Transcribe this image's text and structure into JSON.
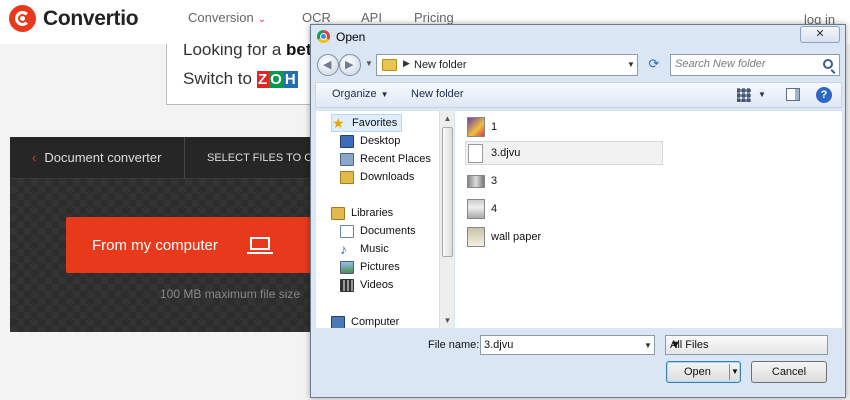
{
  "site": {
    "logo_text": "Convertio",
    "nav": {
      "conversion": "Conversion",
      "ocr": "OCR",
      "api": "API",
      "pricing": "Pricing",
      "login": "log in"
    },
    "ad": {
      "line1_prefix": "Looking for a ",
      "line1_bold": "bett",
      "line2": "Switch to",
      "zoho": [
        "Z",
        "O",
        "H",
        "O"
      ]
    },
    "converter": {
      "back_label": "Document converter",
      "select_label": "SELECT FILES TO CONV",
      "from_computer": "From my computer",
      "max_size": "100 MB maximum file size"
    }
  },
  "dialog": {
    "title": "Open",
    "close": "✕",
    "address_path": "New folder",
    "search_placeholder": "Search New folder",
    "toolbar": {
      "organize": "Organize",
      "new_folder": "New folder",
      "help": "?"
    },
    "tree": [
      {
        "label": "Favorites",
        "icon": "star-icon"
      },
      {
        "label": "Desktop",
        "icon": "desktop-icon"
      },
      {
        "label": "Recent Places",
        "icon": "recent-places-icon"
      },
      {
        "label": "Downloads",
        "icon": "downloads-icon"
      },
      {
        "label": "Libraries",
        "icon": "libraries-icon"
      },
      {
        "label": "Documents",
        "icon": "documents-icon"
      },
      {
        "label": "Music",
        "icon": "music-icon"
      },
      {
        "label": "Pictures",
        "icon": "pictures-icon"
      },
      {
        "label": "Videos",
        "icon": "videos-icon"
      },
      {
        "label": "Computer",
        "icon": "computer-icon"
      }
    ],
    "files": [
      {
        "name": "1",
        "icon": "image-file-icon"
      },
      {
        "name": "3.djvu",
        "icon": "document-file-icon",
        "selected": true
      },
      {
        "name": "3",
        "icon": "image-file-icon"
      },
      {
        "name": "4",
        "icon": "image-file-icon"
      },
      {
        "name": "wall paper",
        "icon": "image-file-icon"
      }
    ],
    "file_name_label": "File name:",
    "file_name_value": "3.djvu",
    "file_type": "All Files",
    "open_label": "Open",
    "cancel_label": "Cancel"
  },
  "colors": {
    "brand": "#e8391d",
    "dialog_bg": "#dbe6f4"
  }
}
